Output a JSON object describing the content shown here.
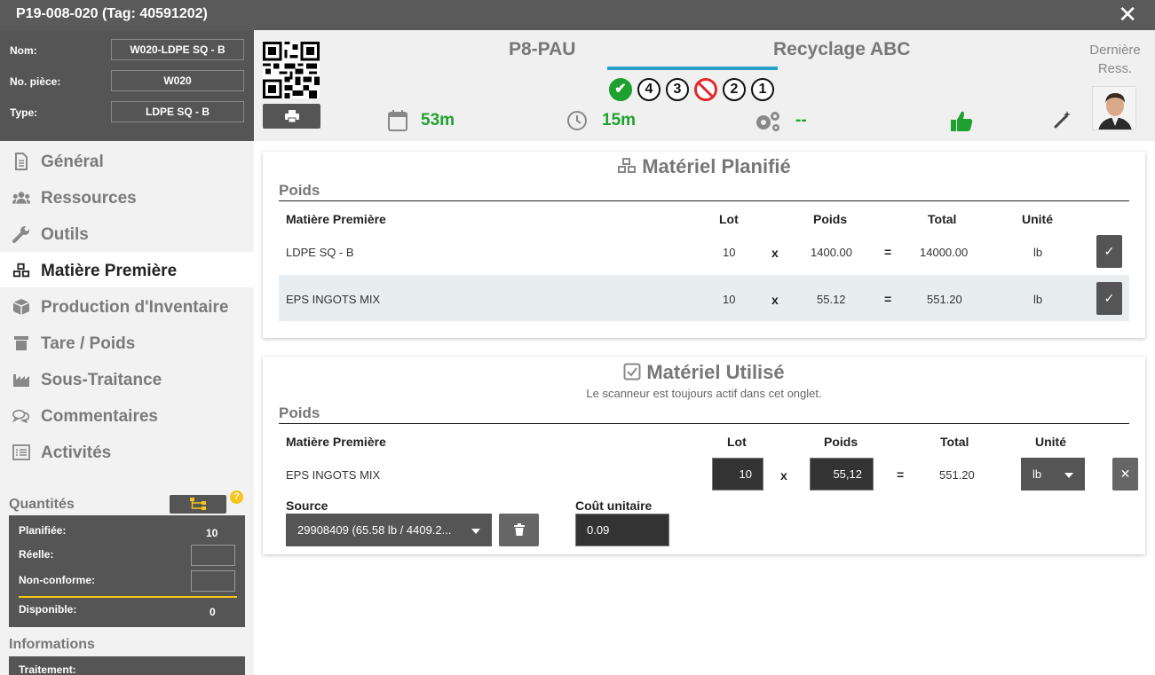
{
  "window": {
    "title": "P19-008-020 (Tag: 40591202)",
    "close_glyph": "✕"
  },
  "info": {
    "name_label": "Nom:",
    "name_value": "W020-LDPE SQ - B",
    "part_label": "No. pièce:",
    "part_value": "W020",
    "type_label": "Type:",
    "type_value": "LDPE SQ - B"
  },
  "header": {
    "machine": "P8-PAU",
    "plant": "Recyclage ABC",
    "steps": [
      "✔",
      "4",
      "3",
      "⊘",
      "2",
      "1"
    ],
    "last_resource": "Dernière Ress.",
    "duration_planned": "53m",
    "duration_actual": "15m",
    "cycle_value": "--"
  },
  "nav": [
    {
      "label": "Général",
      "icon": "document-icon"
    },
    {
      "label": "Ressources",
      "icon": "users-icon"
    },
    {
      "label": "Outils",
      "icon": "wrench-icon"
    },
    {
      "label": "Matière Première",
      "icon": "cubes-icon"
    },
    {
      "label": "Production d'Inventaire",
      "icon": "box-icon"
    },
    {
      "label": "Tare / Poids",
      "icon": "scale-icon"
    },
    {
      "label": "Sous-Traitance",
      "icon": "factory-icon"
    },
    {
      "label": "Commentaires",
      "icon": "comments-icon"
    },
    {
      "label": "Activités",
      "icon": "list-icon"
    }
  ],
  "quantities": {
    "title": "Quantités",
    "help": "?",
    "planned_label": "Planifiée:",
    "planned_value": "10",
    "real_label": "Réelle:",
    "nonconform_label": "Non-conforme:",
    "available_label": "Disponible:",
    "available_value": "0"
  },
  "informations": {
    "title": "Informations",
    "treatment_label": "Traitement:"
  },
  "planned": {
    "title": "Matériel Planifié",
    "section": "Poids",
    "headers": {
      "material": "Matière Première",
      "lot": "Lot",
      "weight": "Poids",
      "total": "Total",
      "unit": "Unité"
    },
    "rows": [
      {
        "material": "LDPE SQ - B",
        "lot": "10",
        "x": "x",
        "weight": "1400.00",
        "eq": "=",
        "total": "14000.00",
        "unit": "lb",
        "check": "✓"
      },
      {
        "material": "EPS INGOTS MIX",
        "lot": "10",
        "x": "x",
        "weight": "55.12",
        "eq": "=",
        "total": "551.20",
        "unit": "lb",
        "check": "✓"
      }
    ]
  },
  "used": {
    "title": "Matériel Utilisé",
    "note": "Le scanneur est toujours actif dans cet onglet.",
    "section": "Poids",
    "headers": {
      "material": "Matière Première",
      "lot": "Lot",
      "weight": "Poids",
      "total": "Total",
      "unit": "Unité"
    },
    "row": {
      "material": "EPS INGOTS MIX",
      "lot": "10",
      "x": "x",
      "weight": "55,12",
      "eq": "=",
      "total": "551.20",
      "unit": "lb",
      "remove": "✕"
    },
    "source_label": "Source",
    "source_value": "29908409 (65.58 lb / 4409.2...",
    "unit_cost_label": "Coût unitaire",
    "unit_cost_value": "0.09"
  }
}
